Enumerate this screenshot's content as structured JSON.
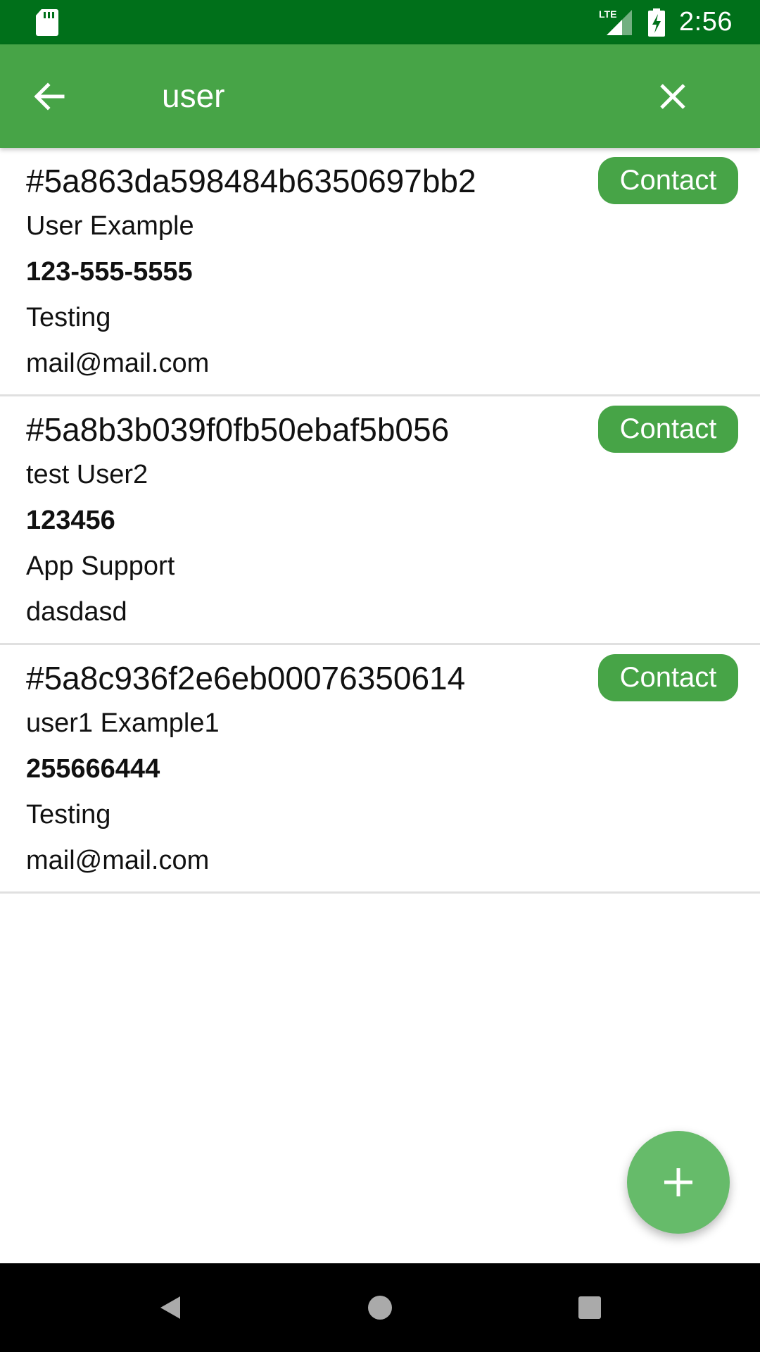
{
  "status_bar": {
    "time": "2:56",
    "network": "LTE",
    "icons": [
      "sd-card-icon",
      "lte-signal-icon",
      "battery-charging-icon"
    ]
  },
  "app_bar": {
    "search_query": "user",
    "back_icon": "arrow-left-icon",
    "clear_icon": "close-icon",
    "color": "#47a447"
  },
  "results": [
    {
      "id": "#5a863da598484b6350697bb2",
      "name": "User Example",
      "phone": "123-555-5555",
      "department": "Testing",
      "email": "mail@mail.com",
      "action_label": "Contact"
    },
    {
      "id": "#5a8b3b039f0fb50ebaf5b056",
      "name": "test User2",
      "phone": "123456",
      "department": "App Support",
      "email": "dasdasd",
      "action_label": "Contact"
    },
    {
      "id": "#5a8c936f2e6eb00076350614",
      "name": "user1 Example1",
      "phone": "255666444",
      "department": "Testing",
      "email": "mail@mail.com",
      "action_label": "Contact"
    }
  ],
  "fab": {
    "icon": "plus-icon",
    "color": "#66bb6a"
  },
  "nav_bar": {
    "icons": [
      "nav-back-icon",
      "nav-home-icon",
      "nav-recents-icon"
    ]
  },
  "colors": {
    "status_bar": "#00701a",
    "accent": "#47a447",
    "divider": "#e0e0e0"
  }
}
